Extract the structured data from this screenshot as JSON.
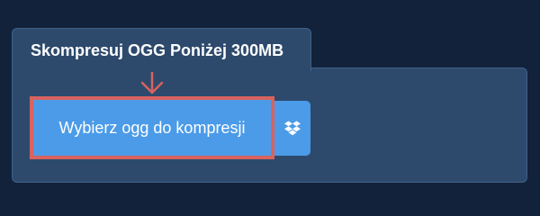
{
  "widget": {
    "title": "Skompresuj OGG Poniżej 300MB",
    "upload_button_label": "Wybierz ogg do kompresji",
    "dropbox_icon": "dropbox-icon",
    "arrow_icon": "arrow-down-icon"
  },
  "colors": {
    "background": "#12223a",
    "panel": "#2d4a6d",
    "button": "#4b9be8",
    "highlight": "#d9625f",
    "text": "#ffffff"
  }
}
